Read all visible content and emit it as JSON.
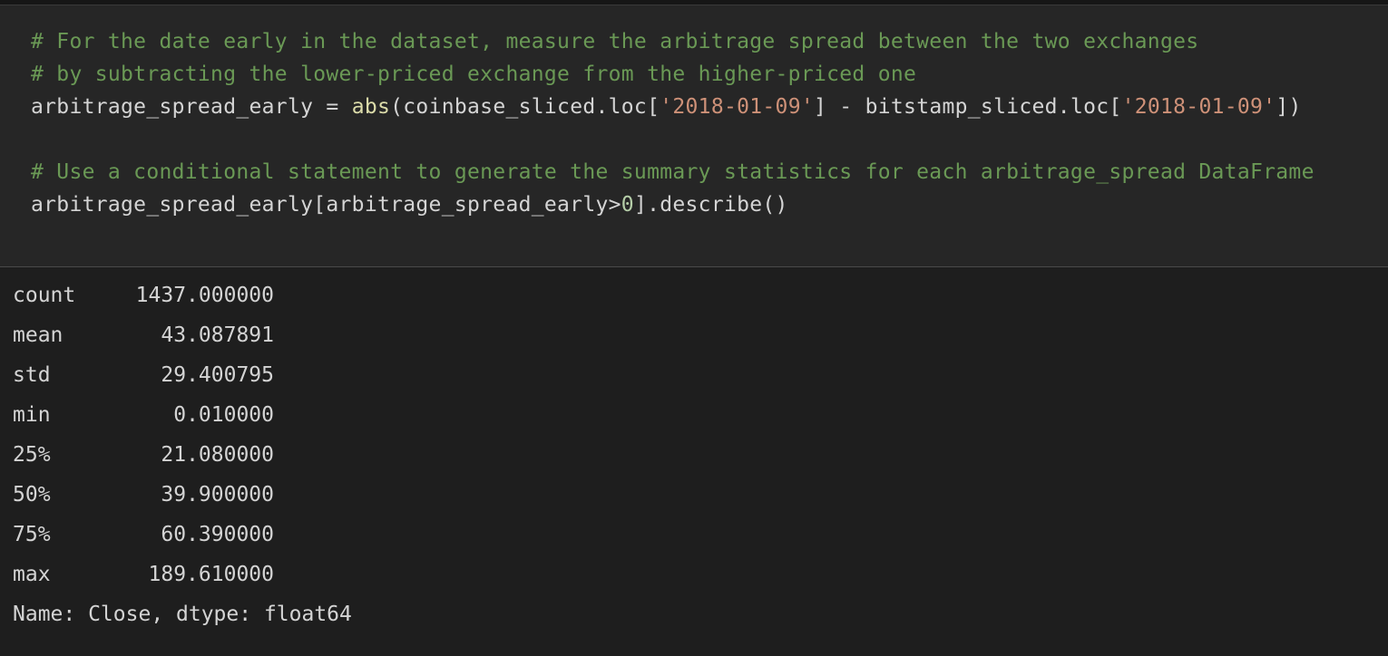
{
  "code": {
    "line1": "# For the date early in the dataset, measure the arbitrage spread between the two exchanges",
    "line2": "# by subtracting the lower-priced exchange from the higher-priced one",
    "line3": {
      "var": "arbitrage_spread_early = ",
      "fn": "abs",
      "open": "(coinbase_sliced.loc[",
      "str1": "'2018-01-09'",
      "mid": "] - bitstamp_sliced.loc[",
      "str2": "'2018-01-09'",
      "close": "])"
    },
    "line5": "# Use a conditional statement to generate the summary statistics for each arbitrage_spread DataFrame",
    "line6": {
      "pre": "arbitrage_spread_early[arbitrage_spread_early>",
      "num": "0",
      "post": "].describe()"
    }
  },
  "output": {
    "rows": [
      {
        "label": "count",
        "value": "1437.000000"
      },
      {
        "label": "mean",
        "value": "43.087891"
      },
      {
        "label": "std",
        "value": "29.400795"
      },
      {
        "label": "min",
        "value": "0.010000"
      },
      {
        "label": "25%",
        "value": "21.080000"
      },
      {
        "label": "50%",
        "value": "39.900000"
      },
      {
        "label": "75%",
        "value": "60.390000"
      },
      {
        "label": "max",
        "value": "189.610000"
      }
    ],
    "footer": "Name: Close, dtype: float64"
  }
}
